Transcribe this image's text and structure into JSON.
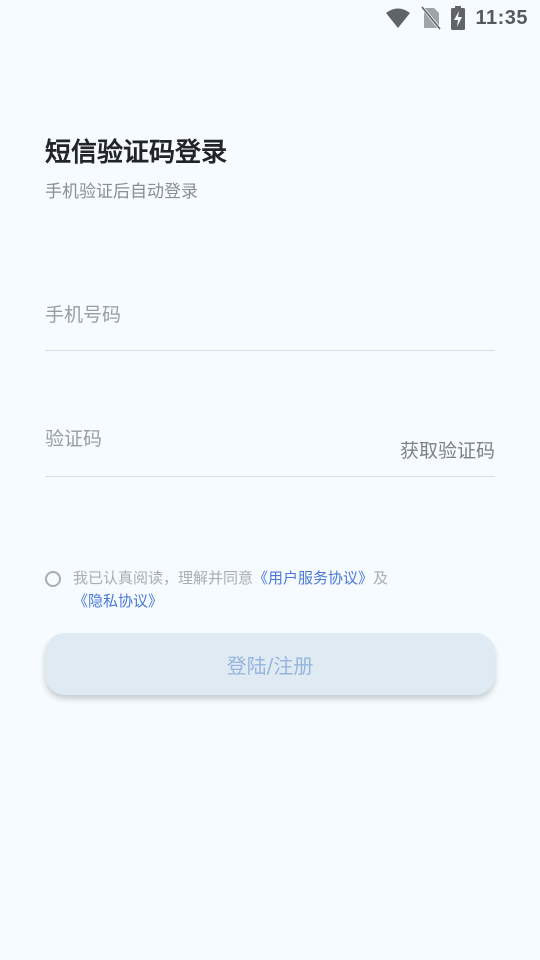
{
  "status_bar": {
    "time": "11:35",
    "icons": [
      "wifi-icon",
      "no-sim-icon",
      "battery-charging-icon"
    ]
  },
  "header": {
    "title": "短信验证码登录",
    "subtitle": "手机验证后自动登录"
  },
  "form": {
    "phone_placeholder": "手机号码",
    "code_placeholder": "验证码",
    "get_code_label": "获取验证码"
  },
  "agreement": {
    "text": "我已认真阅读，理解并同意",
    "user_agreement_link": "《用户服务协议》",
    "connector": "及",
    "privacy_link": "《隐私协议》",
    "checked": false
  },
  "login_button": {
    "label": "登陆/注册"
  },
  "colors": {
    "background": "#f5fbfe",
    "link": "#4a78d8",
    "button_bg": "#e0eaf3",
    "button_text": "#95b5de"
  }
}
